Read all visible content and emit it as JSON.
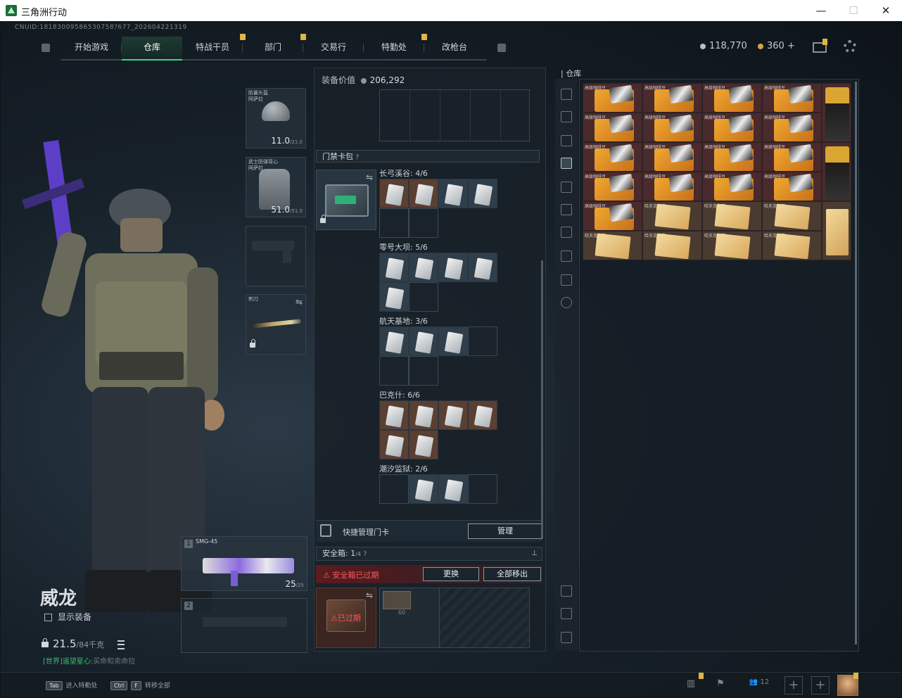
{
  "window": {
    "title": "三角洲行动",
    "minimize": "—",
    "maximize": "☐",
    "close": "✕"
  },
  "uid": "CNUID:18183009586530758?677_202604221319",
  "nav": {
    "tabs": [
      {
        "label": "开始游戏",
        "notif": false
      },
      {
        "label": "仓库",
        "notif": false,
        "active": true
      },
      {
        "label": "特战干员",
        "notif": true
      },
      {
        "label": "部门",
        "notif": true
      },
      {
        "label": "交易行",
        "notif": false
      },
      {
        "label": "特勤处",
        "notif": true
      },
      {
        "label": "改枪台",
        "notif": false
      }
    ]
  },
  "currency": {
    "silver": "118,770",
    "gold": "360",
    "plus": "+"
  },
  "character": {
    "name": "威龙",
    "show_equipment": "显示装备",
    "weight": "21.5",
    "weight_max": "/84千克",
    "chat_channel": "[世界]",
    "chat_user": "遥望星心:",
    "chat_msg": "买命和卖命拉"
  },
  "equipment": {
    "helmet": {
      "label": "防暴头盔\n阿萨拉",
      "durability": "11.0",
      "max": "/21.0"
    },
    "armor": {
      "label": "武士防弹背心\n阿萨拉",
      "durability": "51.0",
      "max": "/51.0"
    },
    "melee": {
      "label": "刺刀"
    },
    "primary": {
      "num": "1",
      "name": "SMG-45",
      "ammo": "25",
      "ammo_max": "/25"
    },
    "secondary": {
      "num": "2"
    }
  },
  "inventory": {
    "equip_value_label": "装备价值",
    "equip_value": "206,292",
    "keycard_section": "门禁卡包",
    "help": "?",
    "groups": [
      {
        "name": "长弓溪谷: 4/6"
      },
      {
        "name": "零号大坝: 5/6"
      },
      {
        "name": "航天基地: 3/6"
      },
      {
        "name": "巴克什: 6/6"
      },
      {
        "name": "潮汐监狱: 2/6"
      }
    ],
    "quick_manage": "快捷管理门卡",
    "manage_btn": "管理",
    "safebox": "安全箱: 1",
    "safebox_max": "/4",
    "safebox_expired": "安全箱已过期",
    "replace_btn": "更换",
    "remove_all_btn": "全部移出",
    "expired_tag": "已过期",
    "item_count": "60"
  },
  "storage": {
    "label": "仓库",
    "coffee_label": "高级咖啡豆",
    "paper_label": "哈夫克机密"
  },
  "bottom": {
    "tab_key": "Tab",
    "tab_hint": "进入特勤处",
    "ctrlf_key": "Ctrl",
    "f_key": "F",
    "ctrlf_hint": "转移全部",
    "friends": "12"
  }
}
